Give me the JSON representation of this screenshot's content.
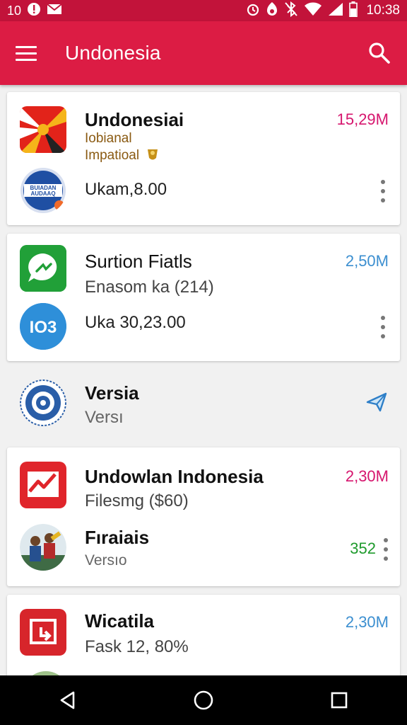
{
  "status_bar": {
    "left_text": "10",
    "left_icons": [
      "alert-icon",
      "mail-icon"
    ],
    "right_icons": [
      "alarm-icon",
      "data-saver-icon",
      "bluetooth-off-icon",
      "wifi-icon",
      "signal-icon",
      "battery-icon"
    ],
    "time": "10:38"
  },
  "app_bar": {
    "title": "Undonesia",
    "menu_icon": "hamburger-icon",
    "search_icon": "search-icon"
  },
  "colors": {
    "brand": "#dc1c44",
    "brand_dark": "#c2133a",
    "pink": "#d6166e",
    "blue": "#3c8fd0",
    "green": "#1e9a2c"
  },
  "items": [
    {
      "title": "Undonesiai",
      "line1": "Iobianal",
      "line2": "Impatioal",
      "value": "Ukam,8.00",
      "size": "15,29M",
      "size_color": "pink",
      "badge_text": "BUIADAN AUDAAQ"
    },
    {
      "title": "Surtion Fiatls",
      "sub": "Enasom ka (214)",
      "value": "Uka 30,23.00",
      "size": "2,50M",
      "size_color": "blue",
      "badge_text": "IO3"
    },
    {
      "title": "Versia",
      "sub": "Versı"
    },
    {
      "title": "Undowlan Indonesia",
      "sub": "Filesmg ($60)",
      "size": "2,30M",
      "size_color": "pink",
      "title2": "Fıraiais",
      "sub2": "Versıo",
      "size2": "352",
      "size2_color": "green"
    },
    {
      "title": "Wicatila",
      "sub": "Fask 12, 80%",
      "size": "2,30M",
      "size_color": "blue"
    }
  ]
}
